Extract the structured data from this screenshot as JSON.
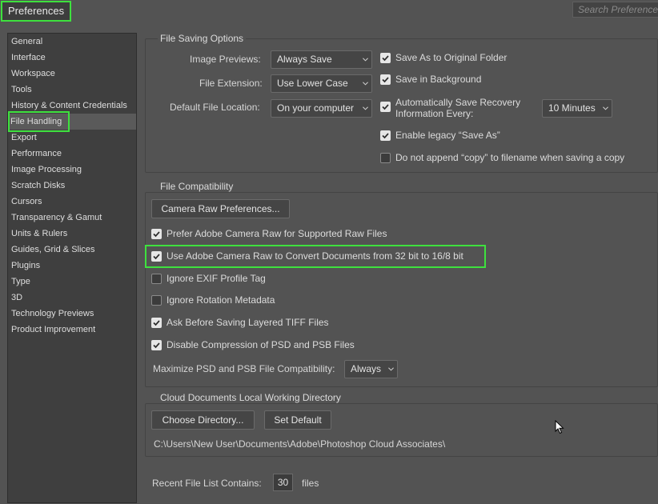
{
  "window": {
    "title": "Preferences",
    "search_placeholder": "Search Preferences"
  },
  "sidebar": {
    "items": [
      {
        "label": "General"
      },
      {
        "label": "Interface"
      },
      {
        "label": "Workspace"
      },
      {
        "label": "Tools"
      },
      {
        "label": "History & Content Credentials"
      },
      {
        "label": "File Handling",
        "selected": true
      },
      {
        "label": "Export"
      },
      {
        "label": "Performance"
      },
      {
        "label": "Image Processing"
      },
      {
        "label": "Scratch Disks"
      },
      {
        "label": "Cursors"
      },
      {
        "label": "Transparency & Gamut"
      },
      {
        "label": "Units & Rulers"
      },
      {
        "label": "Guides, Grid & Slices"
      },
      {
        "label": "Plugins"
      },
      {
        "label": "Type"
      },
      {
        "label": "3D"
      },
      {
        "label": "Technology Previews"
      },
      {
        "label": "Product Improvement"
      }
    ]
  },
  "file_saving": {
    "title": "File Saving Options",
    "image_previews_label": "Image Previews:",
    "image_previews_value": "Always Save",
    "file_extension_label": "File Extension:",
    "file_extension_value": "Use Lower Case",
    "default_location_label": "Default File Location:",
    "default_location_value": "On your computer",
    "save_as_original": {
      "label": "Save As to Original Folder",
      "checked": true
    },
    "save_in_background": {
      "label": "Save in Background",
      "checked": true
    },
    "auto_recovery": {
      "label_line1": "Automatically Save Recovery",
      "label_line2": "Information Every:",
      "checked": true
    },
    "auto_recovery_interval": "10 Minutes",
    "legacy_save_as": {
      "label": "Enable legacy “Save As”",
      "checked": true
    },
    "no_copy": {
      "label": "Do not append “copy” to filename when saving a copy",
      "checked": false
    }
  },
  "file_compat": {
    "title": "File Compatibility",
    "camera_raw_prefs_button": "Camera Raw Preferences...",
    "options": [
      {
        "label": "Prefer Adobe Camera Raw for Supported Raw Files",
        "checked": true
      },
      {
        "label": "Use Adobe Camera Raw to Convert Documents from 32 bit to 16/8 bit",
        "checked": true
      },
      {
        "label": "Ignore EXIF Profile Tag",
        "checked": false
      },
      {
        "label": "Ignore Rotation Metadata",
        "checked": false
      },
      {
        "label": "Ask Before Saving Layered TIFF Files",
        "checked": true
      },
      {
        "label": "Disable Compression of PSD and PSB Files",
        "checked": true
      }
    ],
    "maximize_label": "Maximize PSD and PSB File Compatibility:",
    "maximize_value": "Always"
  },
  "cloud_docs": {
    "title": "Cloud Documents Local Working Directory",
    "choose_button": "Choose Directory...",
    "default_button": "Set Default",
    "path": "C:\\Users\\New User\\Documents\\Adobe\\Photoshop Cloud Associates\\"
  },
  "recent": {
    "label": "Recent File List Contains:",
    "value": "30",
    "suffix": "files"
  },
  "colors": {
    "panel_bg": "#535353",
    "sidebar_bg": "#3f3f3f",
    "highlight": "#3ee13e"
  }
}
